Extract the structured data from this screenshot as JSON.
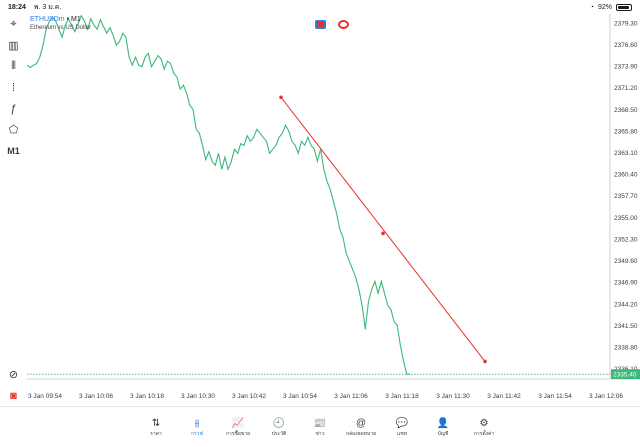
{
  "status": {
    "time": "18:24",
    "date": "พ. 3 ม.ค.",
    "battery": "92%",
    "battery_level": 0.92
  },
  "symbol": {
    "name": "ETHUSDm",
    "separator": "•",
    "timeframe": "M1",
    "description": "Ethereum vs US Dollar"
  },
  "toolbar": [
    {
      "name": "crosshair-icon",
      "glyph": "⌖"
    },
    {
      "name": "candlestick-icon",
      "glyph": "▥"
    },
    {
      "name": "indicators-icon",
      "glyph": "⫴"
    },
    {
      "name": "objects-icon",
      "glyph": "⁞"
    },
    {
      "name": "function-icon",
      "glyph": "ƒ"
    },
    {
      "name": "shapes-icon",
      "glyph": "⬠"
    },
    {
      "name": "timeframe-label",
      "glyph": "M1"
    }
  ],
  "colors": {
    "price_line": "#3bb87a",
    "trend_line": "#e8302a",
    "current_price_bg": "#3bb87a",
    "accent": "#2a7de1"
  },
  "chart_data": {
    "type": "line",
    "x_ticks": [
      "3 Jan 09:54",
      "3 Jan 10:06",
      "3 Jan 10:18",
      "3 Jan 10:30",
      "3 Jan 10:42",
      "3 Jan 10:54",
      "3 Jan 11:06",
      "3 Jan 11:18",
      "3 Jan 11:30",
      "3 Jan 11:42",
      "3 Jan 11:54",
      "3 Jan 12:06"
    ],
    "y_ticks": [
      "2379.30",
      "2376.60",
      "2373.90",
      "2371.20",
      "2368.50",
      "2365.80",
      "2363.10",
      "2360.40",
      "2357.70",
      "2355.00",
      "2352.30",
      "2349.60",
      "2346.90",
      "2344.20",
      "2341.50",
      "2338.80",
      "2336.10"
    ],
    "ylim": [
      2334.8,
      2380.4
    ],
    "current_price": "2335.40",
    "series": [
      {
        "values": [
          2374.0,
          2373.7,
          2374.0,
          2374.2,
          2375.0,
          2376.5,
          2378.5,
          2379.5,
          2380.0,
          2379.5,
          2378.5,
          2377.5,
          2379.0,
          2379.8,
          2379.0,
          2378.2,
          2379.2,
          2380.2,
          2379.5,
          2378.5,
          2379.8,
          2379.0,
          2378.5,
          2379.7,
          2378.8,
          2378.0,
          2378.7,
          2377.7,
          2376.5,
          2377.0,
          2378.0,
          2377.5,
          2375.0,
          2374.0,
          2375.0,
          2374.0,
          2373.8,
          2375.0,
          2375.5,
          2373.8,
          2374.5,
          2375.2,
          2374.8,
          2373.5,
          2374.5,
          2374.2,
          2373.0,
          2372.5,
          2371.0,
          2371.5,
          2370.5,
          2369.0,
          2368.5,
          2366.0,
          2365.5,
          2364.0,
          2362.2,
          2363.2,
          2362.0,
          2361.5,
          2363.0,
          2361.0,
          2362.5,
          2361.0,
          2362.0,
          2363.5,
          2363.0,
          2364.2,
          2364.0,
          2365.2,
          2364.5,
          2365.0,
          2366.0,
          2365.5,
          2365.0,
          2364.5,
          2363.0,
          2363.5,
          2364.0,
          2365.0,
          2365.5,
          2366.5,
          2365.8,
          2364.5,
          2364.0,
          2363.0,
          2364.5,
          2364.0,
          2365.0,
          2364.0,
          2363.5,
          2362.0,
          2363.5,
          2361.0,
          2359.5,
          2358.5,
          2357.0,
          2355.5,
          2353.5,
          2352.5,
          2350.5,
          2349.5,
          2348.5,
          2347.5,
          2346.0,
          2344.0,
          2341.0,
          2344.5,
          2346.0,
          2347.0,
          2345.5,
          2347.0,
          2345.5,
          2344.0,
          2343.5,
          2342.0,
          2341.5,
          2339.0,
          2337.0,
          2335.4,
          2335.4
        ]
      }
    ],
    "trendline": {
      "points": [
        {
          "x_tick": 5,
          "y": 2370.0
        },
        {
          "x_tick": 7,
          "y": 2353.0
        },
        {
          "x_tick": 9,
          "y": 2337.0
        }
      ]
    }
  },
  "nav": [
    {
      "label": "ราคา",
      "icon": "⇅",
      "name": "nav-quotes",
      "active": false
    },
    {
      "label": "กราฟ",
      "icon": "⫵",
      "name": "nav-chart",
      "active": true
    },
    {
      "label": "การซื้อขาย",
      "icon": "📈",
      "name": "nav-trade",
      "active": false
    },
    {
      "label": "ประวัติ",
      "icon": "🕘",
      "name": "nav-history",
      "active": false
    },
    {
      "label": "ข่าว",
      "icon": "📰",
      "name": "nav-news",
      "active": false
    },
    {
      "label": "กล่องจดหมาย",
      "icon": "@",
      "name": "nav-mailbox",
      "active": false
    },
    {
      "label": "แชท",
      "icon": "💬",
      "name": "nav-chat",
      "active": false
    },
    {
      "label": "บัญชี",
      "icon": "👤",
      "name": "nav-accounts",
      "active": false
    },
    {
      "label": "การตั้งค่า",
      "icon": "⚙",
      "name": "nav-settings",
      "active": false
    }
  ]
}
